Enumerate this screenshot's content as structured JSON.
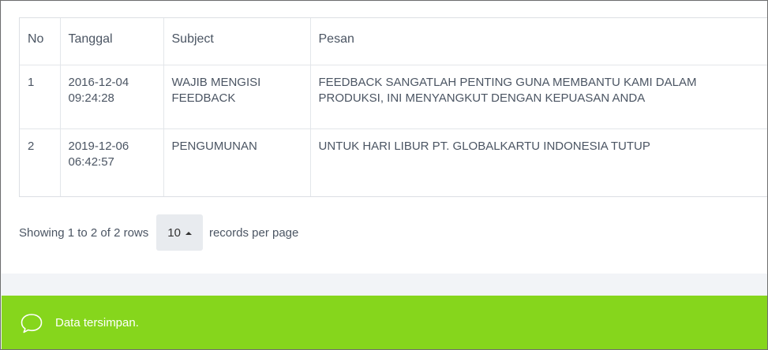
{
  "table": {
    "columns": [
      "No",
      "Tanggal",
      "Subject",
      "Pesan"
    ],
    "rows": [
      {
        "no": "1",
        "date": "2016-12-04",
        "time": "09:24:28",
        "subject_line1": "WAJIB MENGISI",
        "subject_line2": "FEEDBACK",
        "message_line1": "FEEDBACK SANGATLAH PENTING GUNA MEMBANTU KAMI DALAM",
        "message_line2": "PRODUKSI, INI MENYANGKUT DENGAN KEPUASAN ANDA"
      },
      {
        "no": "2",
        "date": "2019-12-06",
        "time": "06:42:57",
        "subject_line1": "PENGUMUNAN",
        "subject_line2": "",
        "message_line1": "UNTUK HARI LIBUR PT. GLOBALKARTU INDONESIA TUTUP",
        "message_line2": ""
      }
    ]
  },
  "pagination": {
    "summary": "Showing 1 to 2 of 2 rows",
    "page_size": "10",
    "suffix": "records per page"
  },
  "toast": {
    "icon": "speech-bubble-icon",
    "message": "Data tersimpan.",
    "background": "#86d61c"
  }
}
